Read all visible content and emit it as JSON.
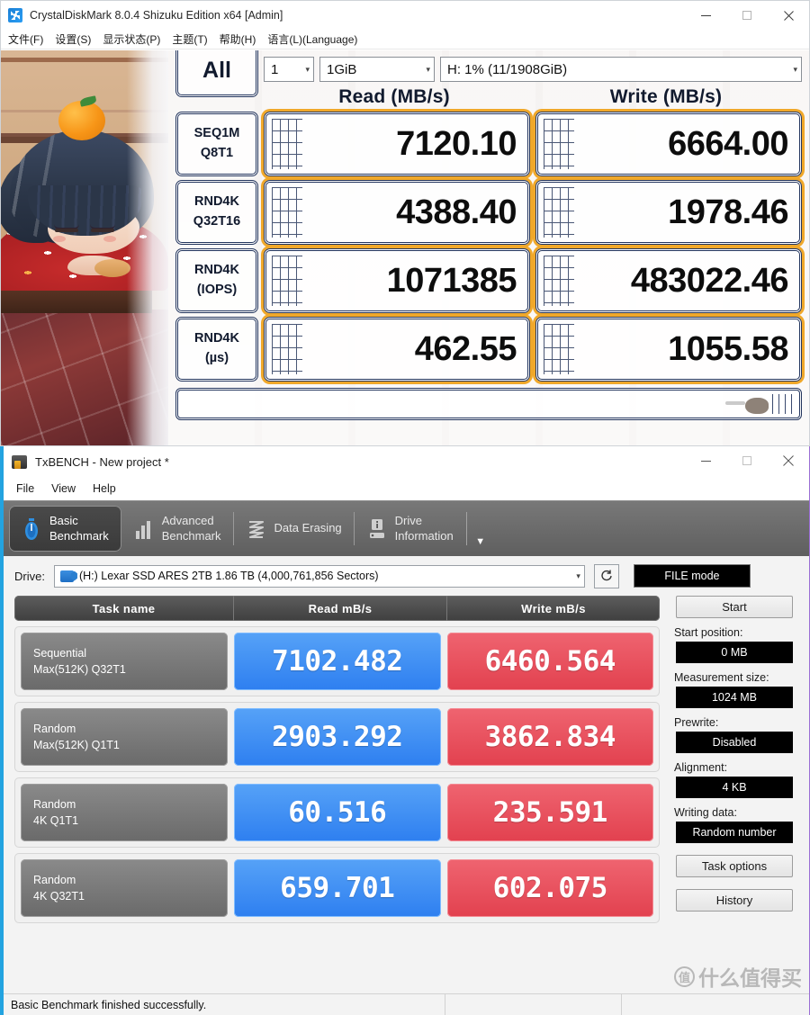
{
  "crystaldiskmark": {
    "title": "CrystalDiskMark 8.0.4 Shizuku Edition x64 [Admin]",
    "app_icon": "crystaldiskmark-icon",
    "window_controls": {
      "minimize": "minimize-icon",
      "maximize": "maximize-icon",
      "close": "close-icon"
    },
    "menu": [
      "文件(F)",
      "设置(S)",
      "显示状态(P)",
      "主题(T)",
      "帮助(H)",
      "语言(L)(Language)"
    ],
    "all_button": "All",
    "test_count": "1",
    "test_size": "1GiB",
    "target_drive": "H: 1% (11/1908GiB)",
    "columns": [
      "Read (MB/s)",
      "Write (MB/s)"
    ],
    "rows": [
      {
        "label_top": "SEQ1M",
        "label_bottom": "Q8T1",
        "read": "7120.10",
        "write": "6664.00"
      },
      {
        "label_top": "RND4K",
        "label_bottom": "Q32T16",
        "read": "4388.40",
        "write": "1978.46"
      },
      {
        "label_top": "RND4K",
        "label_bottom": "(IOPS)",
        "read": "1071385",
        "write": "483022.46"
      },
      {
        "label_top": "RND4K",
        "label_bottom": "(µs)",
        "read": "462.55",
        "write": "1055.58"
      }
    ],
    "progress_text": "",
    "artwork": "shizuku-kotatsu-illustration"
  },
  "txbench": {
    "title": "TxBENCH - New project *",
    "app_icon": "txbench-icon",
    "window_controls": {
      "minimize": "minimize-icon",
      "maximize": "maximize-icon",
      "close": "close-icon"
    },
    "menu": [
      "File",
      "View",
      "Help"
    ],
    "tabs": [
      {
        "label_top": "Basic",
        "label_bottom": "Benchmark",
        "icon": "stopwatch-icon",
        "active": true
      },
      {
        "label_top": "Advanced",
        "label_bottom": "Benchmark",
        "icon": "bar-chart-icon",
        "active": false
      },
      {
        "label_top": "Data Erasing",
        "label_bottom": "",
        "icon": "shredder-icon",
        "active": false
      },
      {
        "label_top": "Drive",
        "label_bottom": "Information",
        "icon": "drive-info-icon",
        "active": false
      }
    ],
    "tab_overflow_icon": "chevron-down-icon",
    "drive_label": "Drive:",
    "drive_value": "(H:) Lexar SSD ARES 2TB  1.86 TB (4,000,761,856 Sectors)",
    "drive_icon": "drive-icon",
    "refresh_icon": "refresh-icon",
    "file_mode": "FILE mode",
    "table": {
      "headers": [
        "Task name",
        "Read mB/s",
        "Write mB/s"
      ],
      "rows": [
        {
          "name_top": "Sequential",
          "name_bottom": "Max(512K) Q32T1",
          "read": "7102.482",
          "write": "6460.564"
        },
        {
          "name_top": "Random",
          "name_bottom": "Max(512K) Q1T1",
          "read": "2903.292",
          "write": "3862.834"
        },
        {
          "name_top": "Random",
          "name_bottom": "4K Q1T1",
          "read": "60.516",
          "write": "235.591"
        },
        {
          "name_top": "Random",
          "name_bottom": "4K Q32T1",
          "read": "659.701",
          "write": "602.075"
        }
      ]
    },
    "side": {
      "start_button": "Start",
      "fields": [
        {
          "label": "Start position:",
          "value": "0 MB"
        },
        {
          "label": "Measurement size:",
          "value": "1024 MB"
        },
        {
          "label": "Prewrite:",
          "value": "Disabled"
        },
        {
          "label": "Alignment:",
          "value": "4 KB"
        },
        {
          "label": "Writing data:",
          "value": "Random number"
        }
      ],
      "task_options_button": "Task options",
      "history_button": "History"
    },
    "statusbar": "Basic Benchmark finished successfully."
  },
  "watermark": {
    "mark": "值",
    "text": "什么值得买"
  },
  "colors": {
    "read_badge": "#2e7ff0",
    "write_badge": "#e2414f",
    "cdm_border": "#23355e",
    "cdm_highlight": "#f0a82a",
    "txbench_accent": "#23a3e0"
  }
}
